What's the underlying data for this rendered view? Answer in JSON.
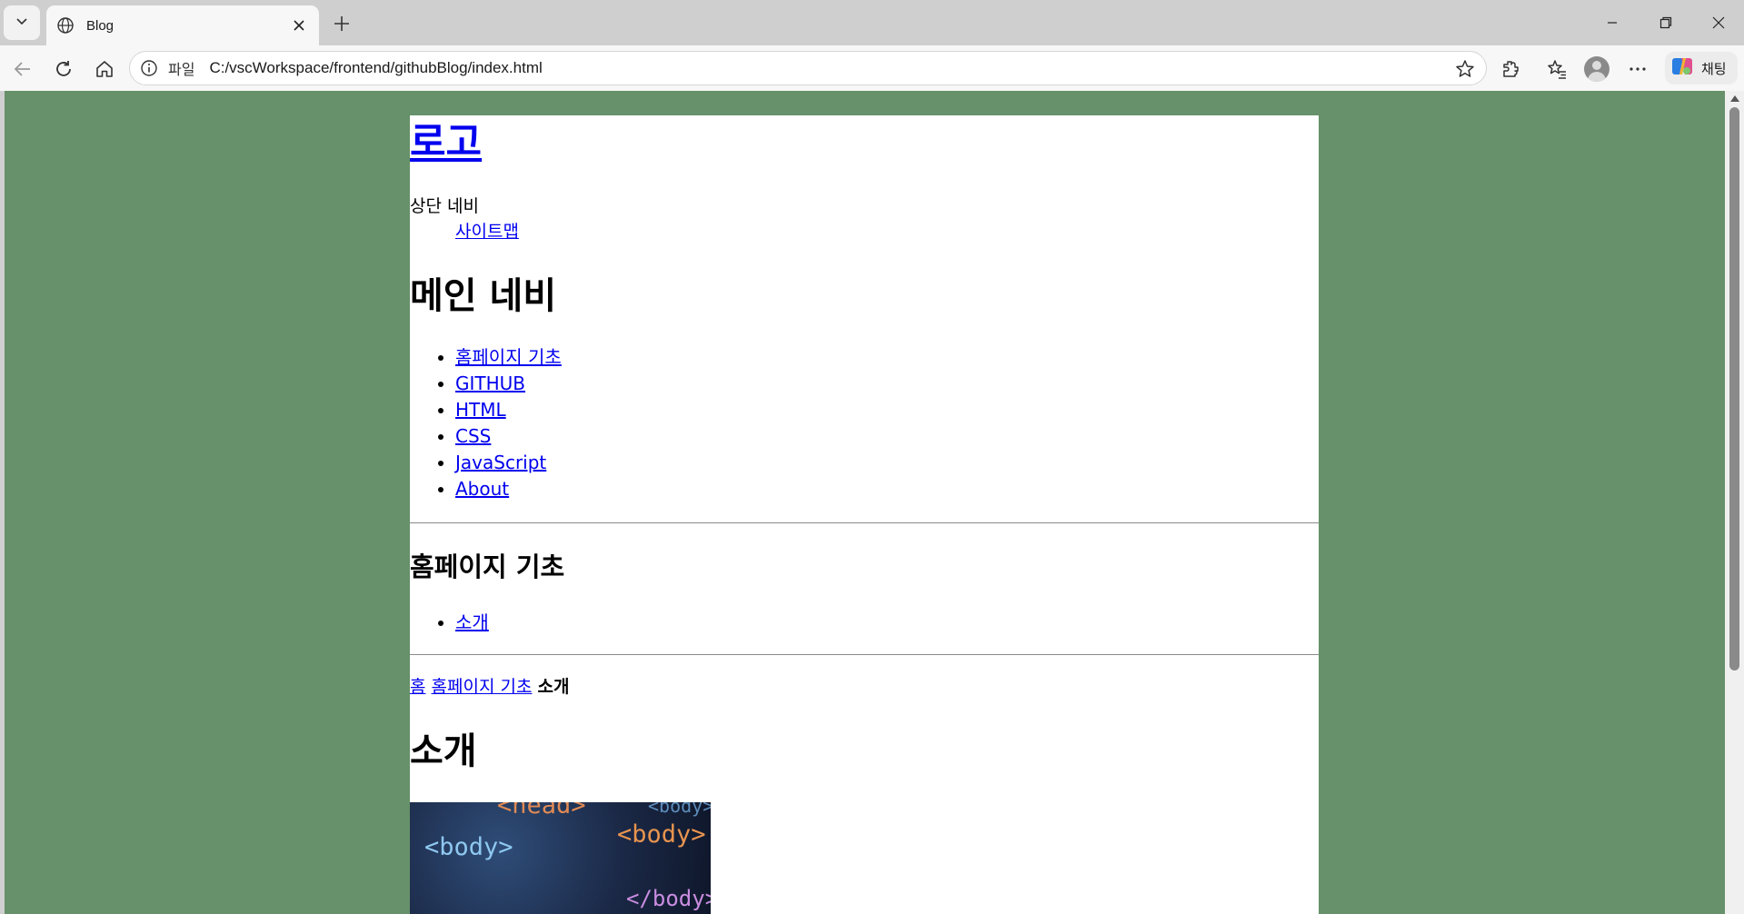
{
  "browser": {
    "tab_title": "Blog",
    "address_scheme": "파일",
    "address_url": "C:/vscWorkspace/frontend/githubBlog/index.html",
    "copilot_label": "채팅"
  },
  "page": {
    "logo": "로고",
    "top_nav_label": "상단 네비",
    "sitemap_link": "사이트맵",
    "main_nav_heading": "메인 네비",
    "main_nav_items": [
      "홈페이지 기초",
      "GITHUB",
      "HTML",
      "CSS",
      "JavaScript",
      "About"
    ],
    "section_heading": "홈페이지 기초",
    "section_items": [
      "소개"
    ],
    "breadcrumb": {
      "home": "홈",
      "parent": "홈페이지 기초",
      "current": "소개"
    },
    "article_title": "소개",
    "image_words": [
      "<head>",
      "<body>",
      "<body>",
      "<body>",
      "</body>"
    ]
  },
  "colors": {
    "page_background": "#66916a",
    "content_background": "#ffffff",
    "link": "#0000ee"
  }
}
